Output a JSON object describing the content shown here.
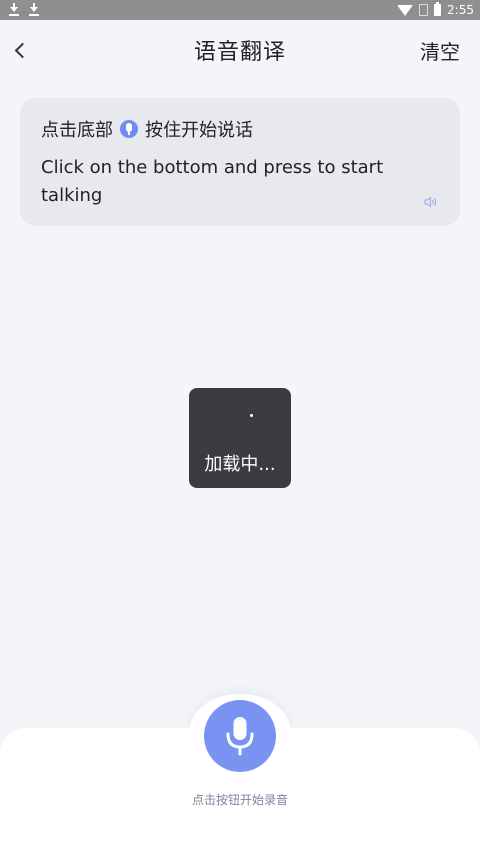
{
  "status_bar": {
    "time": "2:55",
    "icons": [
      "download-icon",
      "download-icon",
      "wifi-icon",
      "sim-icon",
      "battery-icon"
    ]
  },
  "header": {
    "title": "语音翻译",
    "clear_label": "清空",
    "back_icon": "chevron-left-icon"
  },
  "message": {
    "prompt_before": "点击底部",
    "prompt_after": "按住开始说话",
    "translation": "Click on the bottom and press to start talking",
    "speaker_icon": "speaker-icon"
  },
  "loading": {
    "text": "加载中..."
  },
  "bottom": {
    "hint": "点击按钮开始录音",
    "mic_icon": "microphone-icon"
  },
  "colors": {
    "accent": "#7a93f2",
    "background": "#f4f5f9",
    "card": "#e8e9ed",
    "toast": "#3a3c3f"
  }
}
